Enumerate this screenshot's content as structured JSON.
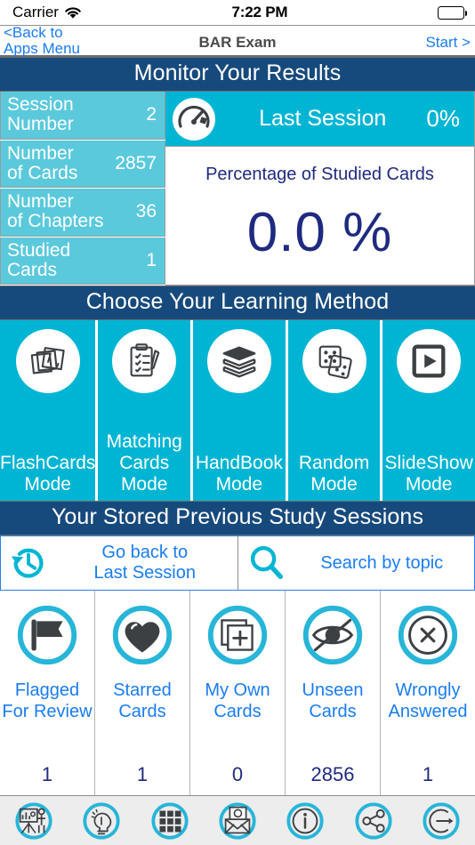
{
  "status_bar": {
    "carrier": "Carrier",
    "time": "7:22 PM",
    "wifi_icon": "wifi-icon",
    "battery_icon": "battery-full-icon"
  },
  "nav_bar": {
    "back_label": "<Back to\nApps Menu",
    "title": "BAR Exam",
    "start_label": "Start >"
  },
  "monitor": {
    "header": "Monitor Your Results",
    "stats": [
      {
        "label": "Session\nNumber",
        "value": "2"
      },
      {
        "label": "Number\nof Cards",
        "value": "2857"
      },
      {
        "label": "Number\nof Chapters",
        "value": "36"
      },
      {
        "label": "Studied\nCards",
        "value": "1"
      }
    ],
    "last_session": {
      "icon": "speedometer-icon",
      "label": "Last Session",
      "percent": "0%"
    },
    "percentage_panel": {
      "caption": "Percentage of Studied Cards",
      "value": "0.0 %"
    }
  },
  "learning": {
    "header": "Choose Your Learning Method",
    "methods": [
      {
        "label": "FlashCards\nMode",
        "icon": "stacked-cards-icon"
      },
      {
        "label": "Matching\nCards\nMode",
        "icon": "clipboard-checklist-icon"
      },
      {
        "label": "HandBook\nMode",
        "icon": "stacked-books-icon"
      },
      {
        "label": "Random\nMode",
        "icon": "dice-icon"
      },
      {
        "label": "SlideShow\nMode",
        "icon": "play-square-icon"
      }
    ]
  },
  "sessions": {
    "header": "Your Stored Previous Study Sessions",
    "tools": [
      {
        "label": "Go back to\nLast Session",
        "icon": "history-clock-icon"
      },
      {
        "label": "Search by topic",
        "icon": "search-icon"
      }
    ]
  },
  "categories": [
    {
      "label": "Flagged\nFor Review",
      "count": "1",
      "icon": "flag-icon"
    },
    {
      "label": "Starred\nCards",
      "count": "1",
      "icon": "heart-icon"
    },
    {
      "label": "My Own\nCards",
      "count": "0",
      "icon": "add-card-icon"
    },
    {
      "label": "Unseen\nCards",
      "count": "2856",
      "icon": "eye-slash-icon"
    },
    {
      "label": "Wrongly\nAnswered",
      "count": "1",
      "icon": "x-circle-icon"
    }
  ],
  "tab_bar": [
    {
      "name": "presentation-icon"
    },
    {
      "name": "brain-bulb-icon"
    },
    {
      "name": "grid-apps-icon"
    },
    {
      "name": "mail-icon"
    },
    {
      "name": "info-icon"
    },
    {
      "name": "share-icon"
    },
    {
      "name": "logout-icon"
    }
  ],
  "colors": {
    "header_navy": "#174A7C",
    "cyan": "#00B5D4",
    "light_cyan": "#5BC9DC",
    "link_blue": "#1a7cf5",
    "value_navy": "#1F2A80",
    "icon_dark": "#3c4043"
  }
}
